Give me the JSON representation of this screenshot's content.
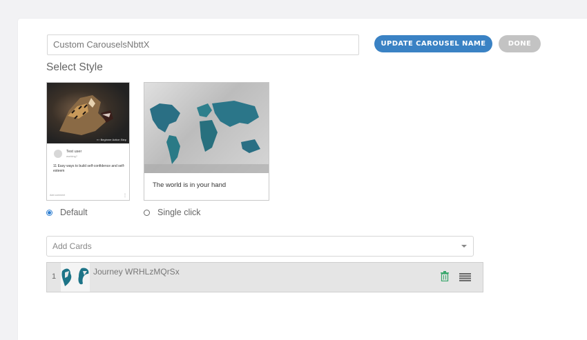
{
  "carousel": {
    "name_value": "Custom CarouselsNbttX",
    "update_label": "UPDATE CAROUSEL NAME",
    "done_label": "DONE"
  },
  "style_section": {
    "title": "Select Style",
    "default_card": {
      "image_caption": "Beginner Action Step",
      "user_name": "Test user",
      "user_status": "working?",
      "text": "11 Easy ways to build self-confidence and self-esteem",
      "add_comment": "Add comment"
    },
    "single_card": {
      "text": "The world is in your hand"
    },
    "options": [
      {
        "label": "Default",
        "selected": true
      },
      {
        "label": "Single click",
        "selected": false
      }
    ]
  },
  "cards": {
    "placeholder": "Add Cards",
    "items": [
      {
        "index": "1",
        "title": "Journey WRHLzMQrSx",
        "delete_icon": "trash-icon",
        "drag_icon": "drag-handle-icon"
      }
    ]
  },
  "colors": {
    "primary_button": "#3a82c4",
    "done_button": "#c3c3c3",
    "radio_selected": "#2f7fd1",
    "delete_icon": "#3aa76d"
  }
}
